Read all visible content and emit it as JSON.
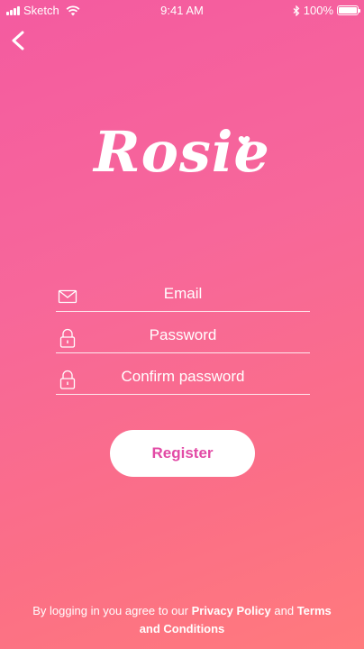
{
  "status_bar": {
    "carrier": "Sketch",
    "time": "9:41 AM",
    "battery": "100%"
  },
  "icons": {
    "back": "chevron-left-icon",
    "email": "envelope-icon",
    "password": "lock-icon",
    "confirm": "lock-icon"
  },
  "logo": {
    "text": "Rosie"
  },
  "form": {
    "email_placeholder": "Email",
    "password_placeholder": "Password",
    "confirm_placeholder": "Confirm password",
    "register_label": "Register"
  },
  "footer": {
    "prefix": "By logging in you agree to our ",
    "privacy_label": "Privacy Policy",
    "connector": " and ",
    "terms_label": "Terms and Conditions"
  },
  "colors": {
    "gradient_top": "#f45ba0",
    "gradient_bottom": "#ff7a7d",
    "button_text": "#e24aa5"
  }
}
